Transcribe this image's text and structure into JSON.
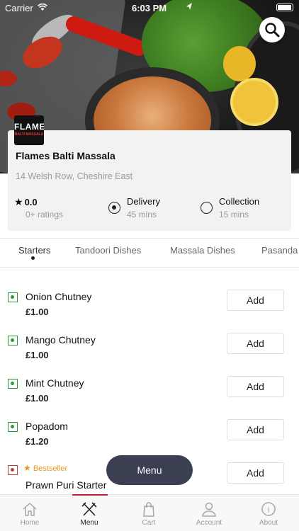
{
  "status_bar": {
    "carrier": "Carrier",
    "time": "6:03 PM"
  },
  "restaurant": {
    "logo_text": "FLAMES",
    "logo_subtext": "BALTI MASSALA",
    "name": "Flames Balti Massala",
    "address": "14 Welsh Row, Cheshire East",
    "rating": "0.0",
    "ratings_count": "0+ ratings"
  },
  "order_options": [
    {
      "label": "Delivery",
      "time": "45 mins",
      "selected": true
    },
    {
      "label": "Collection",
      "time": "15 mins",
      "selected": false
    }
  ],
  "tabs": [
    {
      "label": "Starters",
      "active": true
    },
    {
      "label": "Tandoori Dishes",
      "active": false
    },
    {
      "label": "Massala Dishes",
      "active": false
    },
    {
      "label": "Pasanda",
      "active": false
    }
  ],
  "items": [
    {
      "name": "Onion Chutney",
      "price": "£1.00",
      "add_label": "Add",
      "veg": true
    },
    {
      "name": "Mango Chutney",
      "price": "£1.00",
      "add_label": "Add",
      "veg": true
    },
    {
      "name": "Mint Chutney",
      "price": "£1.00",
      "add_label": "Add",
      "veg": true
    },
    {
      "name": "Popadom",
      "price": "£1.20",
      "add_label": "Add",
      "veg": true
    },
    {
      "name": "Prawn Puri Starter",
      "badge": "Bestseller",
      "add_label": "Add",
      "veg": false
    }
  ],
  "menu_button": "Menu",
  "bottom_nav": [
    {
      "label": "Home",
      "icon": "home-icon",
      "active": false
    },
    {
      "label": "Menu",
      "icon": "fork-knife-icon",
      "active": true
    },
    {
      "label": "Cart",
      "icon": "bag-icon",
      "active": false
    },
    {
      "label": "Account",
      "icon": "user-icon",
      "active": false
    },
    {
      "label": "About",
      "icon": "info-icon",
      "active": false
    }
  ],
  "colors": {
    "accent": "#c7243a",
    "menu_button_bg": "#3b3f52",
    "veg_green": "#2a9a3a",
    "nonveg_red": "#b5453b",
    "bestseller": "#e39a1c"
  }
}
